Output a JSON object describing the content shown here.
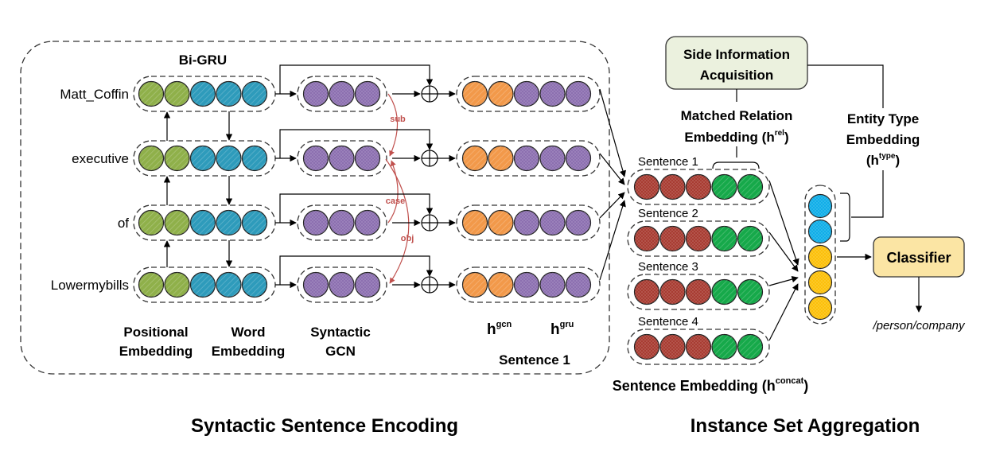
{
  "encoding": {
    "section_title": "Syntactic Sentence Encoding",
    "bigru_label": "Bi-GRU",
    "words": [
      "Matt_Coffin",
      "executive",
      "of",
      "Lowermybills"
    ],
    "column_labels": {
      "positional": [
        "Positional",
        "Embedding"
      ],
      "word": [
        "Word",
        "Embedding"
      ],
      "gcn": [
        "Syntactic",
        "GCN"
      ],
      "hgcn": {
        "base": "h",
        "sup": "gcn"
      },
      "hgru": {
        "base": "h",
        "sup": "gru"
      },
      "sentence": "Sentence 1"
    },
    "dependency_edges": [
      {
        "label": "sub",
        "from": 0,
        "to": 1
      },
      {
        "label": "case",
        "from": 2,
        "to": 1
      },
      {
        "label": "obj",
        "from": 1,
        "to": 3
      }
    ],
    "colors": {
      "positional": "#8fb04a",
      "word": "#2e9bbb",
      "gcn": "#8c6fb0",
      "hgcn": "#f2994a",
      "dependency": "#c0504d"
    }
  },
  "aggregation": {
    "section_title": "Instance Set Aggregation",
    "side_info_box": [
      "Side Information",
      "Acquisition"
    ],
    "matched_relation": {
      "line1": "Matched Relation",
      "line2": "Embedding (h",
      "sup": "rel",
      "close": ")"
    },
    "entity_type": {
      "line1": "Entity Type",
      "line2": "Embedding",
      "line3_open": "(h",
      "sup": "type",
      "close": ")"
    },
    "sentences": [
      "Sentence 1",
      "Sentence 2",
      "Sentence 3",
      "Sentence 4"
    ],
    "sentence_embedding": {
      "text": "Sentence Embedding (h",
      "sup": "concat",
      "close": ")"
    },
    "classifier_label": "Classifier",
    "output_label": "/person/company",
    "colors": {
      "sentence_red": "#a83c32",
      "sentence_green": "#16a94a",
      "type_blue": "#10aee8",
      "agg_yellow": "#fcc00a",
      "side_box_fill": "#ebf1de",
      "classifier_fill": "#fbe5a4"
    }
  }
}
